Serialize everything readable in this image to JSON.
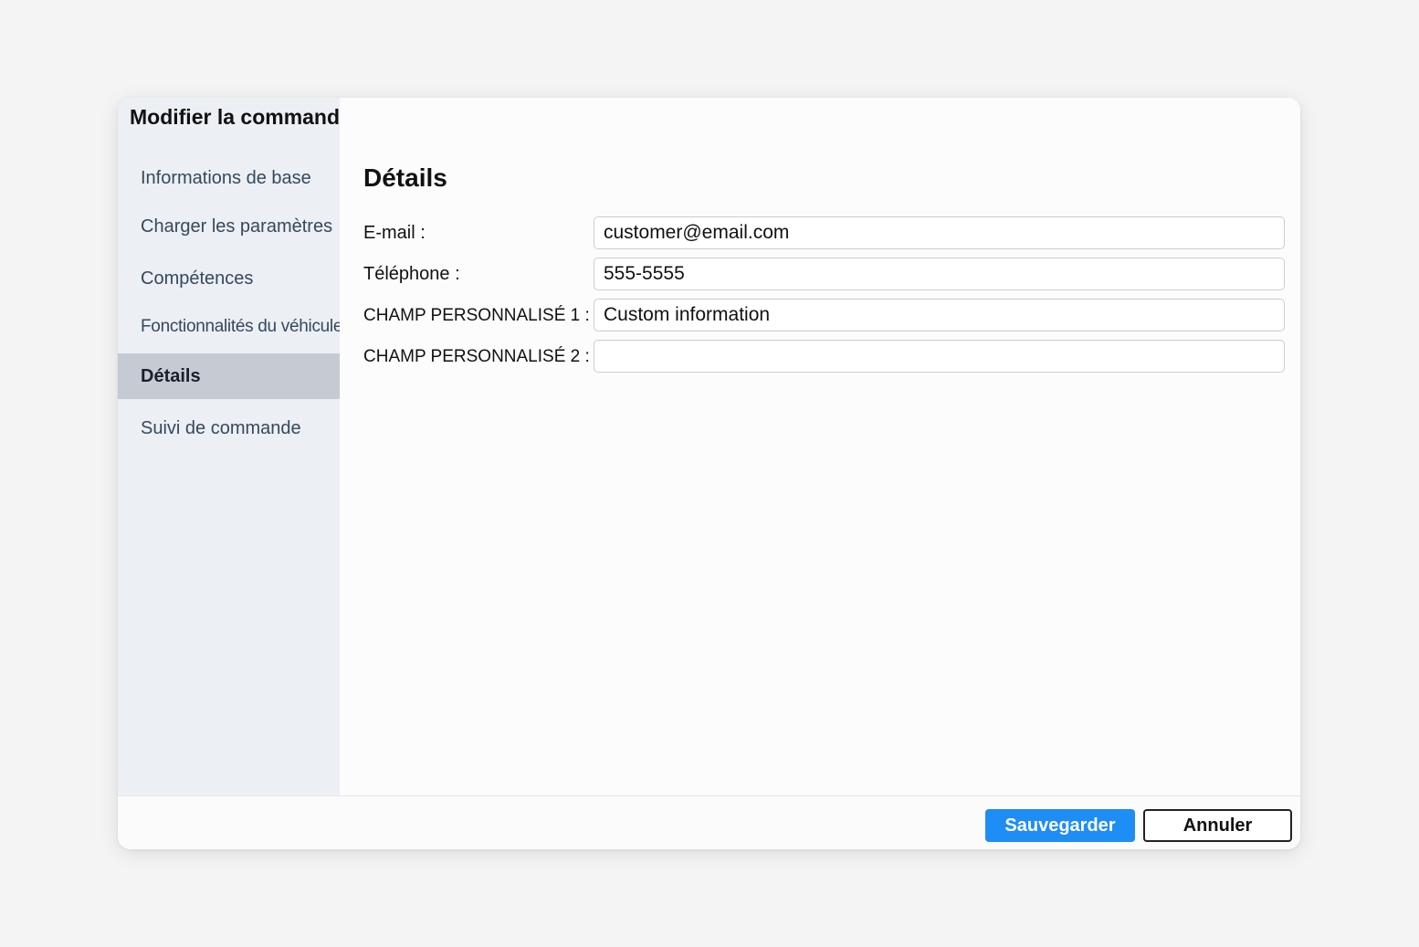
{
  "dialog": {
    "title": "Modifier la commande"
  },
  "sidebar": {
    "items": [
      {
        "label": "Informations de base",
        "active": false
      },
      {
        "label": "Charger les paramètres",
        "active": false
      },
      {
        "label": "Compétences",
        "active": false
      },
      {
        "label": "Fonctionnalités du véhicule",
        "active": false
      },
      {
        "label": "Détails",
        "active": true
      },
      {
        "label": "Suivi de commande",
        "active": false
      }
    ]
  },
  "main": {
    "section_title": "Détails",
    "fields": [
      {
        "label": "E-mail :",
        "value": "customer@email.com"
      },
      {
        "label": "Téléphone :",
        "value": "555-5555"
      },
      {
        "label": "CHAMP PERSONNALISÉ 1 :",
        "value": "Custom information"
      },
      {
        "label": "CHAMP PERSONNALISÉ 2 :",
        "value": ""
      }
    ]
  },
  "footer": {
    "save_label": "Sauvegarder",
    "cancel_label": "Annuler"
  },
  "colors": {
    "accent": "#1e8df5",
    "sidebar_bg": "#eceff3",
    "active_item_bg": "#c5cad3"
  }
}
